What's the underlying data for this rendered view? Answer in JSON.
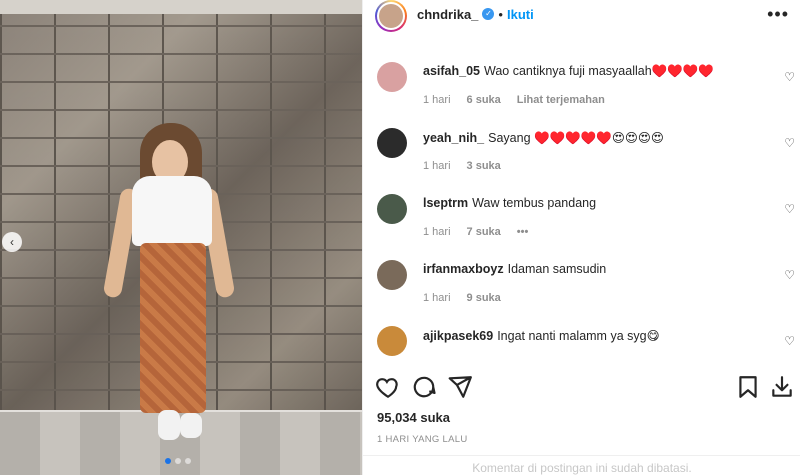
{
  "post": {
    "username": "chndrika_",
    "separator": "•",
    "follow_label": "Ikuti",
    "likes": "95,034 suka",
    "time": "1 HARI YANG LALU",
    "comments_closed": "Komentar di postingan ini sudah dibatasi."
  },
  "comments": [
    {
      "user": "asifah_05",
      "text": "Wao cantiknya fuji masyaallah♥️♥️♥️♥️",
      "time": "1 hari",
      "likes": "6 suka",
      "extra": "Lihat terjemahan",
      "avatar_color": "#d9a1a1"
    },
    {
      "user": "yeah_nih_",
      "text": "Sayang ♥️♥️♥️♥️♥️😍😍😍😍",
      "time": "1 hari",
      "likes": "3 suka",
      "extra": "",
      "avatar_color": "#2b2b2b"
    },
    {
      "user": "lseptrm",
      "text": "Waw tembus pandang",
      "time": "1 hari",
      "likes": "7 suka",
      "extra": "•••",
      "avatar_color": "#4a5a4a"
    },
    {
      "user": "irfanmaxboyz",
      "text": "Idaman samsudin",
      "time": "1 hari",
      "likes": "9 suka",
      "extra": "",
      "avatar_color": "#7a6a5a"
    },
    {
      "user": "ajikpasek69",
      "text": "Ingat nanti malamm ya syg😋",
      "time": "",
      "likes": "",
      "extra": "",
      "avatar_color": "#c98a3a"
    }
  ],
  "icons": {
    "like": "heart-icon",
    "comment": "comment-icon",
    "share": "send-icon",
    "save": "bookmark-icon",
    "download": "download-icon",
    "more": "more-icon",
    "carousel": "chevron-left-icon"
  },
  "colors": {
    "follow": "#0095f6",
    "verified": "#3897f0",
    "muted": "#8e8e8e"
  }
}
